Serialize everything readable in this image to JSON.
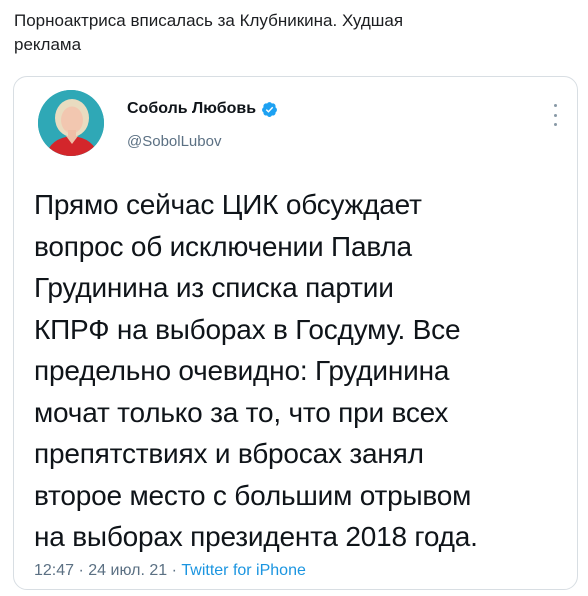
{
  "caption": "Порноактриса вписалась за Клубникина. Худшая\nреклама",
  "tweet": {
    "author_name": "Соболь Любовь",
    "author_handle": "@SobolLubov",
    "verified": true,
    "text": "Прямо сейчас ЦИК обсуждает\nвопрос об исключении Павла\nГрудинина из списка партии\nКПРФ на выборах в Госдуму. Все\nпредельно очевидно: Грудинина\nмочат только за то, что при всех\nпрепятствиях и вбросах занял\nвторое место с большим отрывом\nна выборах президента 2018 года.",
    "time": "12:47",
    "date": "24 июл. 21",
    "separator": "·",
    "source": "Twitter for iPhone"
  },
  "icons": {
    "verified": "verified-badge-icon",
    "more": "more-options-icon"
  },
  "colors": {
    "link": "#1b95e0",
    "verified": "#1da1f2",
    "muted": "#5b7083",
    "avatar_bg": "#2fa8b6"
  }
}
